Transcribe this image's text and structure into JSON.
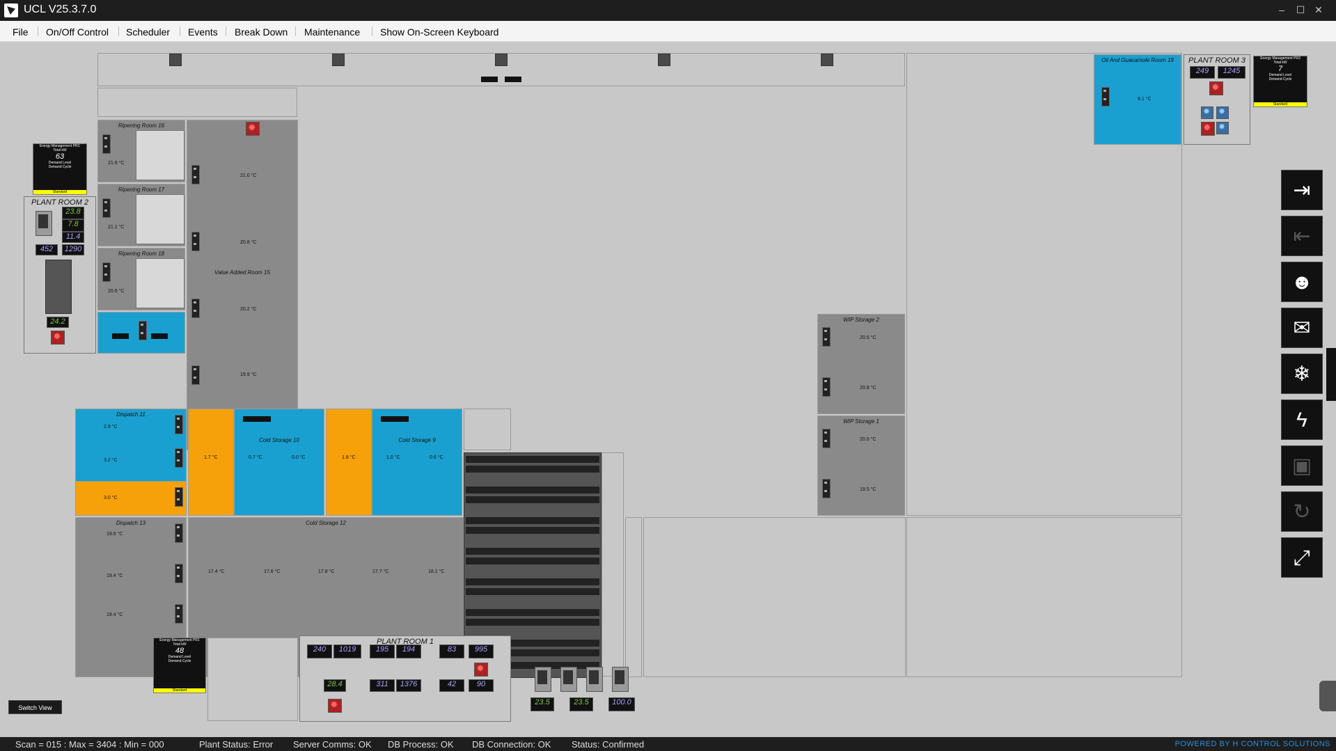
{
  "app": {
    "title": "UCL V25.3.7.0"
  },
  "menu": [
    "File",
    "On/Off Control",
    "Scheduler",
    "Events",
    "Break Down",
    "Maintenance",
    "Show On-Screen Keyboard"
  ],
  "rooms": {
    "ripening16": "Ripening Room 16",
    "ripening17": "Ripening Room 17",
    "ripening18": "Ripening Room 18",
    "value_added15": "Value Added Room 15",
    "dispatch11": "Dispatch 11",
    "dispatch13": "Dispatch 13",
    "cold10": "Cold Storage 10",
    "cold9": "Cold Storage 9",
    "cold12": "Cold Storage 12",
    "wip2": "WIP Storage 2",
    "wip1": "WIP Storage 1",
    "oil_guac": "Oil And Guacamole Room 19",
    "plant1": "PLANT ROOM 1",
    "plant2": "PLANT ROOM 2",
    "plant3": "PLANT ROOM 3"
  },
  "temps": {
    "ripening16": "21.6 °C",
    "ripening17": "21.1 °C",
    "ripening18": "20.6 °C",
    "corr1": "21.0 °C",
    "corr2": "20.8 °C",
    "corr3": "20.2 °C",
    "corr4": "19.9 °C",
    "d11a": "2.9 °C",
    "d11b": "3.2 °C",
    "d11c": "3.0 °C",
    "c10a": "1.7 °C",
    "c10b": "0.7 °C",
    "c10c": "0.0 °C",
    "c9a": "1.8 °C",
    "c9b": "1.0 °C",
    "c9c": "0.6 °C",
    "d13a": "19.6 °C",
    "d13b": "19.4 °C",
    "d13c": "19.4 °C",
    "c12a": "17.4 °C",
    "c12b": "17.6 °C",
    "c12c": "17.8 °C",
    "c12d": "17.7 °C",
    "c12e": "18.1 °C",
    "wip2a": "20.5 °C",
    "wip2b": "20.8 °C",
    "wip1a": "20.0 °C",
    "wip1b": "19.5 °C",
    "oil": "8.1 °C"
  },
  "energy": {
    "prc": {
      "title": "Energy Management PRC",
      "kw_label": "Total kW",
      "kw": "63",
      "level_label": "Demand Level",
      "cycle_label": "Demand Cycle",
      "mode": "Standard"
    },
    "pr1": {
      "title": "Energy Management PR1",
      "kw_label": "Total kW",
      "kw": "48",
      "level_label": "Demand Level",
      "cycle_label": "Demand Cycle",
      "mode": "Standard"
    },
    "pr3": {
      "title": "Energy Management PR3",
      "kw_label": "Total kW",
      "kw": "7",
      "level_label": "Demand Level",
      "cycle_label": "Demand Cycle",
      "mode": "Standard"
    }
  },
  "plant2": {
    "drybulb": "23.8",
    "wetbulb": "7.8",
    "ambient": "24.2",
    "suction": "452",
    "discharge": "1290",
    "rh": "11.4"
  },
  "plant3": {
    "suction": "249",
    "discharge": "1245"
  },
  "plant1": {
    "suction_a": "240",
    "discharge_a": "1019",
    "suction_b": "195",
    "discharge_b": "194",
    "suction_c": "83",
    "discharge_c": "995",
    "suction_d": "311",
    "discharge_d": "1376",
    "suction_e": "42",
    "discharge_e": "90",
    "ambient": "28.4"
  },
  "outdoor": {
    "drybulb": "23.5",
    "wetbulb": "23.5",
    "rh": "100.0"
  },
  "switch_view": "Switch View",
  "status": {
    "scan": "Scan = 015 : Max = 3404 : Min = 000",
    "plant": "Plant Status: Error",
    "server": "Server Comms: OK",
    "dbproc": "DB Process:  OK",
    "dbconn": "DB Connection:  OK",
    "status": "Status:  Confirmed",
    "powered": "POWERED BY H CONTROL SOLUTIONS"
  },
  "sidebar_icons": [
    "login-icon",
    "logout-icon",
    "user-settings-icon",
    "mail-icon",
    "defrost-icon",
    "power-icon",
    "save-icon",
    "refresh-icon",
    "fullscreen-icon"
  ],
  "colors": {
    "cold": "#1aa0d0",
    "warm": "#f7a10a",
    "room": "#8a8a8a",
    "accent": "#2a8fe0"
  }
}
